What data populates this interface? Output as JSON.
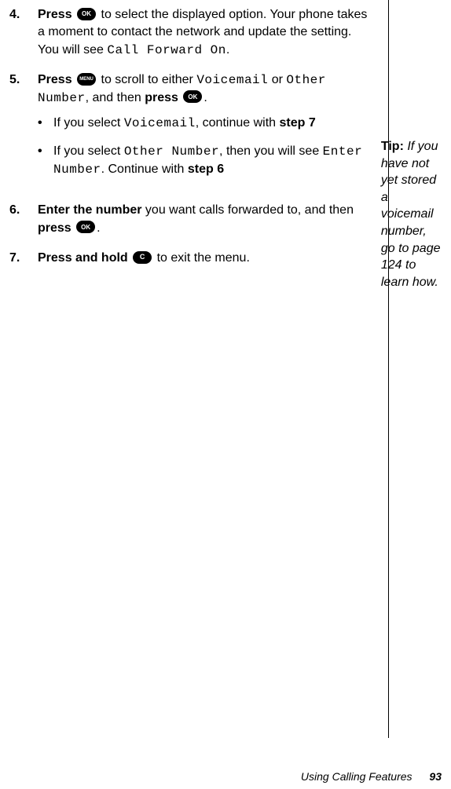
{
  "steps": {
    "s4": {
      "num": "4.",
      "press": "Press",
      "btn": "OK",
      "text1": " to select the displayed option. Your phone takes a moment to contact the network and update the setting. You will see ",
      "lcd1": "Call Forward On",
      "text2": "."
    },
    "s5": {
      "num": "5.",
      "press": "Press",
      "btn": "MENU",
      "text1": " to scroll to either ",
      "lcd1": "Voicemail",
      "text2": " or ",
      "lcd2": "Other Number",
      "text3": ", and then ",
      "press2": "press",
      "btn2": "OK",
      "text4": ".",
      "sub1": {
        "text1": "If you select ",
        "lcd1": "Voicemail",
        "text2": ", continue with ",
        "bold1": "step 7"
      },
      "sub2": {
        "text1": "If you select ",
        "lcd1": "Other Number",
        "text2": ", then you will see ",
        "lcd2": "Enter Number",
        "text3": ". Continue with ",
        "bold1": "step 6"
      }
    },
    "s6": {
      "num": "6.",
      "bold1": "Enter the number",
      "text1": " you want calls forwarded to, and then ",
      "press": "press",
      "btn": "OK",
      "text2": "."
    },
    "s7": {
      "num": "7.",
      "bold1": "Press and hold",
      "btn": "C",
      "text1": " to exit the menu."
    }
  },
  "tip": {
    "label": "Tip:",
    "body": " If you have not yet stored a voicemail number, go to page 124 to learn how."
  },
  "footer": {
    "section": "Using Calling Features",
    "page": "93"
  }
}
